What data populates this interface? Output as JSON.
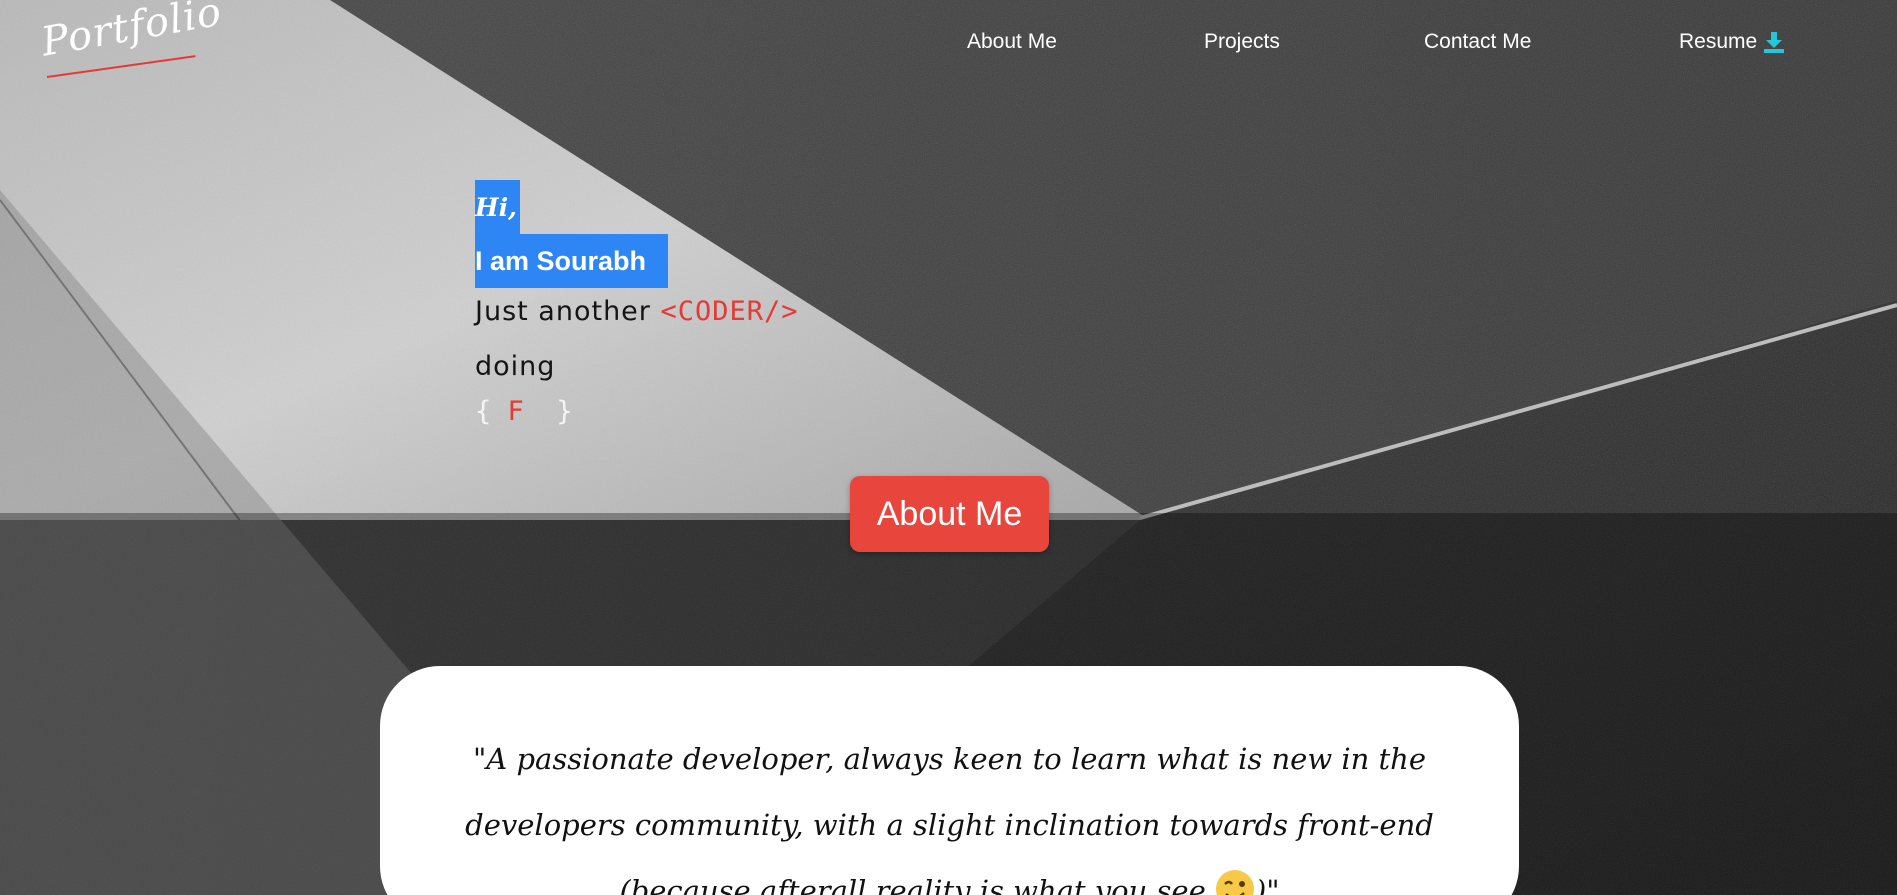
{
  "nav": {
    "logo_text": "Portfolio",
    "links": {
      "about": "About Me",
      "projects": "Projects",
      "contact": "Contact Me",
      "resume": "Resume"
    },
    "resume_icon": "download-icon"
  },
  "hero": {
    "greeting": "Hi,",
    "name_line": "I am Sourabh",
    "tagline_prefix": "Just another ",
    "tagline_highlight": "<CODER/>",
    "doing": "doing",
    "brace_open": "{ ",
    "typed_word": "F",
    "brace_close": "  }"
  },
  "about_button": "About Me",
  "quote": {
    "text": "\"A passionate developer, always keen to learn what is new in the developers community, with a slight inclination towards front-end (because afterall reality is what you see ",
    "emoji": "winking-face-icon",
    "closing": ")\""
  },
  "colors": {
    "accent_red": "#e53935",
    "selection_blue": "#2e86f5",
    "button_red": "#e8453c",
    "download_teal": "#26c6da"
  }
}
